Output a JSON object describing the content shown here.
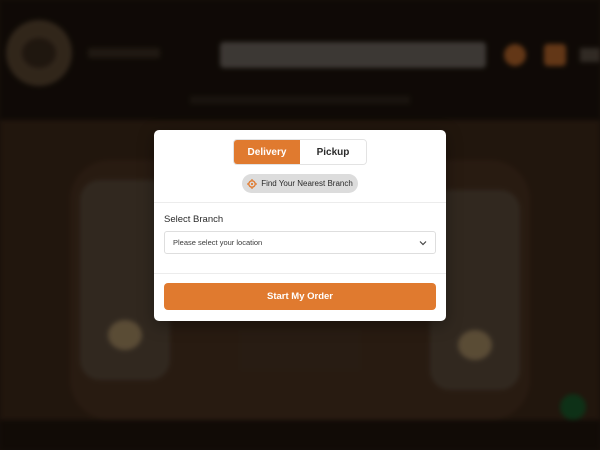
{
  "colors": {
    "accent": "#e07a2f",
    "modal_bg": "#ffffff",
    "find_bg": "#dcdcdc"
  },
  "modal": {
    "tabs": [
      {
        "label": "Delivery",
        "active": true
      },
      {
        "label": "Pickup",
        "active": false
      }
    ],
    "find_branch": {
      "label": "Find Your Nearest Branch",
      "icon": "locate-icon"
    },
    "branch": {
      "label": "Select Branch",
      "selected": "Please select your location",
      "icon": "chevron-down-icon"
    },
    "start_button": "Start My Order"
  }
}
